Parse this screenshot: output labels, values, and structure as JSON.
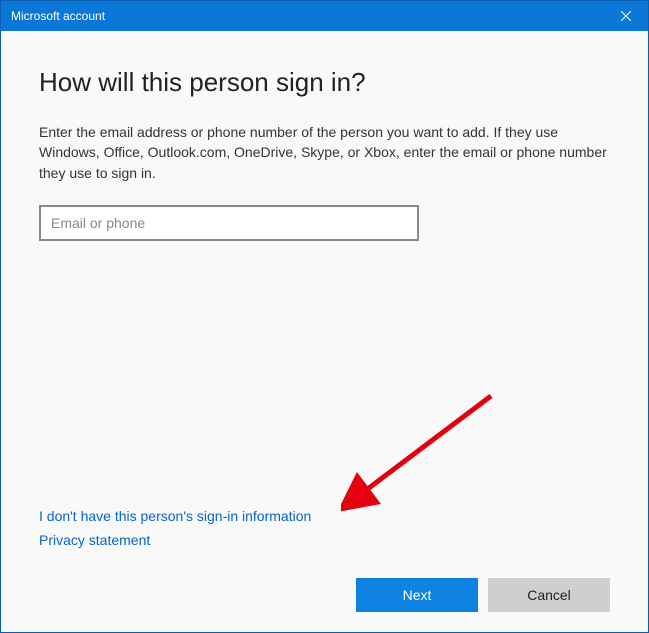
{
  "titlebar": {
    "title": "Microsoft account"
  },
  "dialog": {
    "heading": "How will this person sign in?",
    "description": "Enter the email address or phone number of the person you want to add. If they use Windows, Office, Outlook.com, OneDrive, Skype, or Xbox, enter the email or phone number they use to sign in.",
    "email_placeholder": "Email or phone",
    "email_value": ""
  },
  "links": {
    "no_info": "I don't have this person's sign-in information",
    "privacy": "Privacy statement"
  },
  "buttons": {
    "next": "Next",
    "cancel": "Cancel"
  }
}
